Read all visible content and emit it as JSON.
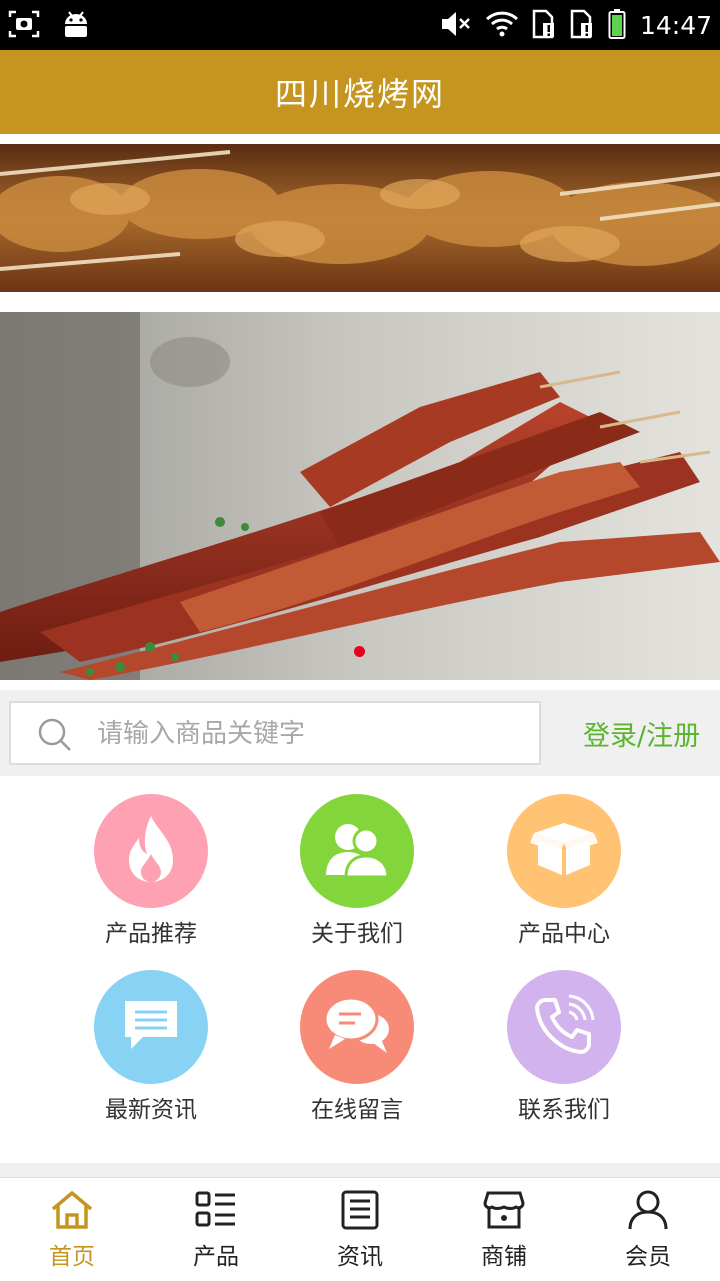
{
  "status_bar": {
    "time": "14:47",
    "left_icons": [
      "screenshot-icon",
      "android-icon"
    ],
    "right_icons": [
      "mute-icon",
      "wifi-icon",
      "sim1-icon",
      "sim2-icon",
      "battery-icon"
    ]
  },
  "header": {
    "title": "四川烧烤网"
  },
  "carousel": {
    "active_index": 0,
    "dot_color": "#e8001c"
  },
  "search": {
    "placeholder": "请输入商品关键字",
    "value": ""
  },
  "login": {
    "label": "登录/注册"
  },
  "menu": {
    "items": [
      {
        "label": "产品推荐",
        "icon": "flame-icon",
        "color": "#fea1b2"
      },
      {
        "label": "关于我们",
        "icon": "users-icon",
        "color": "#82d63c"
      },
      {
        "label": "产品中心",
        "icon": "box-icon",
        "color": "#ffc373"
      },
      {
        "label": "最新资讯",
        "icon": "message-icon",
        "color": "#88d2f4"
      },
      {
        "label": "在线留言",
        "icon": "chat-icon",
        "color": "#f78b77"
      },
      {
        "label": "联系我们",
        "icon": "phone-icon",
        "color": "#d3b3ee"
      }
    ]
  },
  "bottom_nav": {
    "active_color": "#c69520",
    "items": [
      {
        "label": "首页",
        "icon": "home-icon"
      },
      {
        "label": "产品",
        "icon": "grid-list-icon"
      },
      {
        "label": "资讯",
        "icon": "news-icon"
      },
      {
        "label": "商铺",
        "icon": "shop-icon"
      },
      {
        "label": "会员",
        "icon": "user-icon"
      }
    ]
  },
  "colors": {
    "brand": "#c69520",
    "accent_green": "#5bb52e"
  }
}
